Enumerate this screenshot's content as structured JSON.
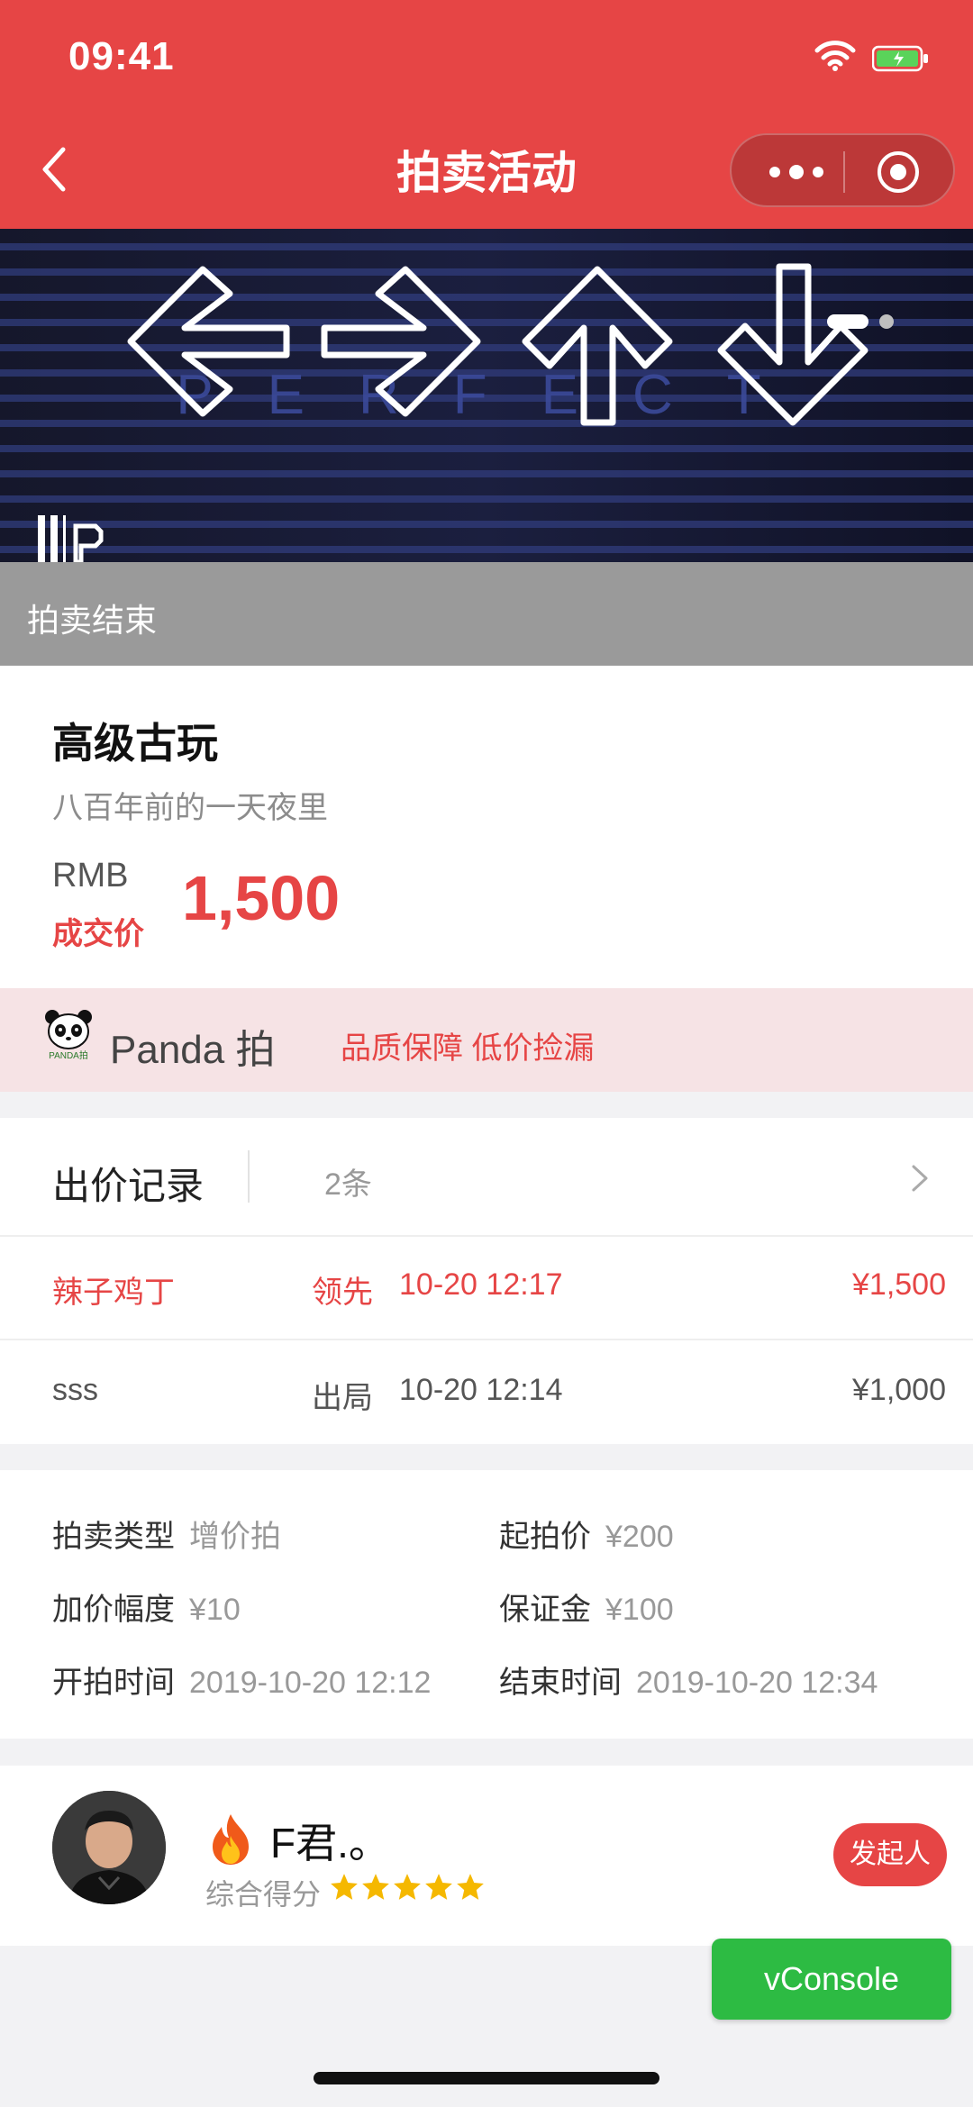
{
  "status_bar": {
    "time": "09:41"
  },
  "nav": {
    "title": "拍卖活动"
  },
  "banner": {
    "overlay_text": "PERFECT",
    "carousel_dots": 2,
    "active_dot": 1
  },
  "auction_status": "拍卖结束",
  "product": {
    "title": "高级古玩",
    "subtitle": "八百年前的一天夜里",
    "currency": "RMB",
    "price_label": "成交价",
    "price": "1,500"
  },
  "brand": {
    "name": "Panda 拍",
    "tagline": "品质保障 低价捡漏",
    "logo_text": "PANDA拍"
  },
  "bids": {
    "title": "出价记录",
    "count": "2条",
    "rows": [
      {
        "bidder": "辣子鸡丁",
        "status": "领先",
        "time": "10-20 12:17",
        "amount": "¥1,500"
      },
      {
        "bidder": "sss",
        "status": "出局",
        "time": "10-20 12:14",
        "amount": "¥1,000"
      }
    ]
  },
  "details": {
    "type": {
      "label": "拍卖类型",
      "value": "增价拍"
    },
    "start_price": {
      "label": "起拍价",
      "value": "¥200"
    },
    "increment": {
      "label": "加价幅度",
      "value": "¥10"
    },
    "deposit": {
      "label": "保证金",
      "value": "¥100"
    },
    "start_time": {
      "label": "开拍时间",
      "value": "2019-10-20 12:12"
    },
    "end_time": {
      "label": "结束时间",
      "value": "2019-10-20 12:34"
    }
  },
  "initiator": {
    "name": "F君.。",
    "score_label": "综合得分",
    "rating": 5,
    "role_button": "发起人"
  },
  "vconsole": {
    "label": "vConsole"
  },
  "colors": {
    "primary": "#e64545",
    "brand_bg": "#f6e3e5",
    "vconsole": "#2dbb43",
    "star": "#f5b800"
  }
}
